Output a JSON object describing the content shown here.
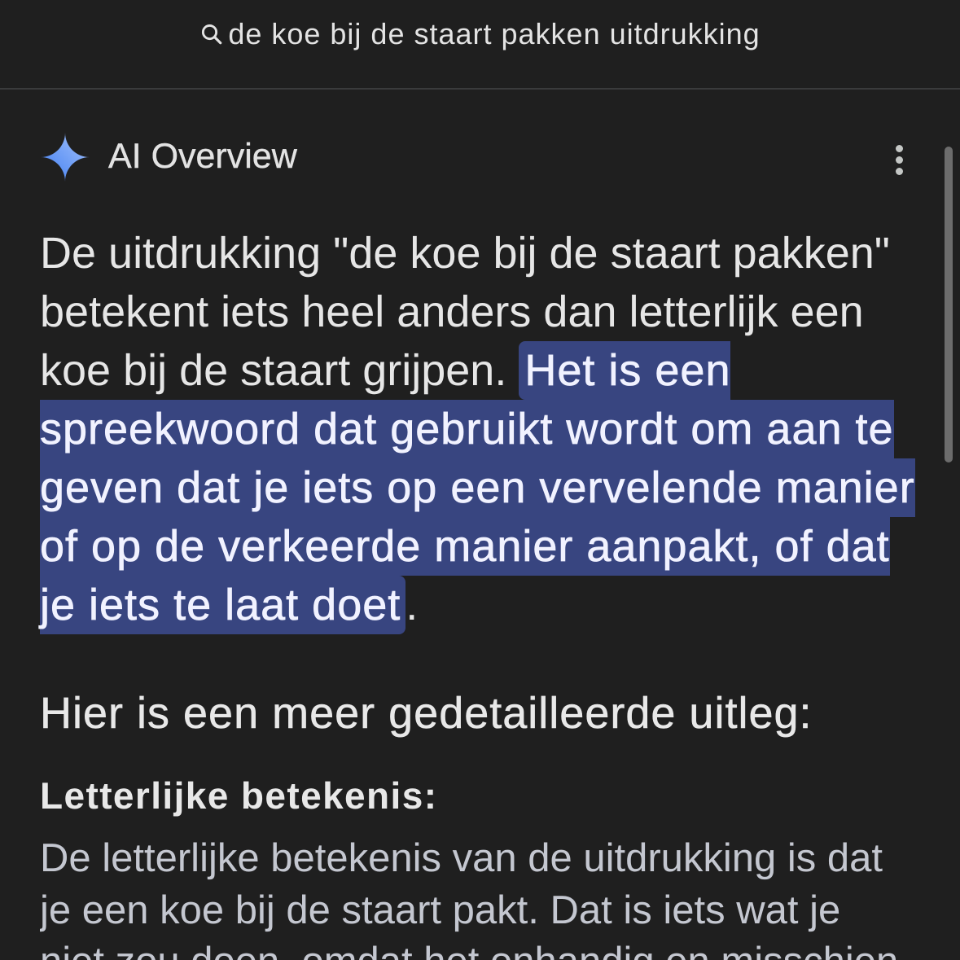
{
  "colors": {
    "background": "#1f1f1f",
    "highlight": "#384580",
    "sparkle_start": "#3d7cf2",
    "sparkle_end": "#a6c4fb"
  },
  "search": {
    "icon": "search-icon",
    "query": "de koe bij de staart pakken uitdrukking"
  },
  "ai_overview": {
    "icon": "sparkle-icon",
    "title": "AI Overview",
    "menu_icon": "more-vert-icon",
    "summary": {
      "text": "De uitdrukking \"de koe bij de staart pakken\" betekent iets heel anders dan letterlijk een koe bij de staart grijpen.",
      "highlighted": "Het is een spreekwoord dat gebruikt wordt om aan te geven dat je iets op een vervelende manier of op de verkeerde manier aanpakt, of dat je iets te laat doet",
      "end": "."
    },
    "subheading": "Hier is een meer gedetailleerde uitleg:",
    "sections": [
      {
        "title": "Letterlijke betekenis:",
        "text": "De letterlijke betekenis van de uitdrukking is dat je een koe bij de staart pakt. Dat is iets wat je niet zou doen, omdat het onhandig en misschien"
      }
    ]
  }
}
